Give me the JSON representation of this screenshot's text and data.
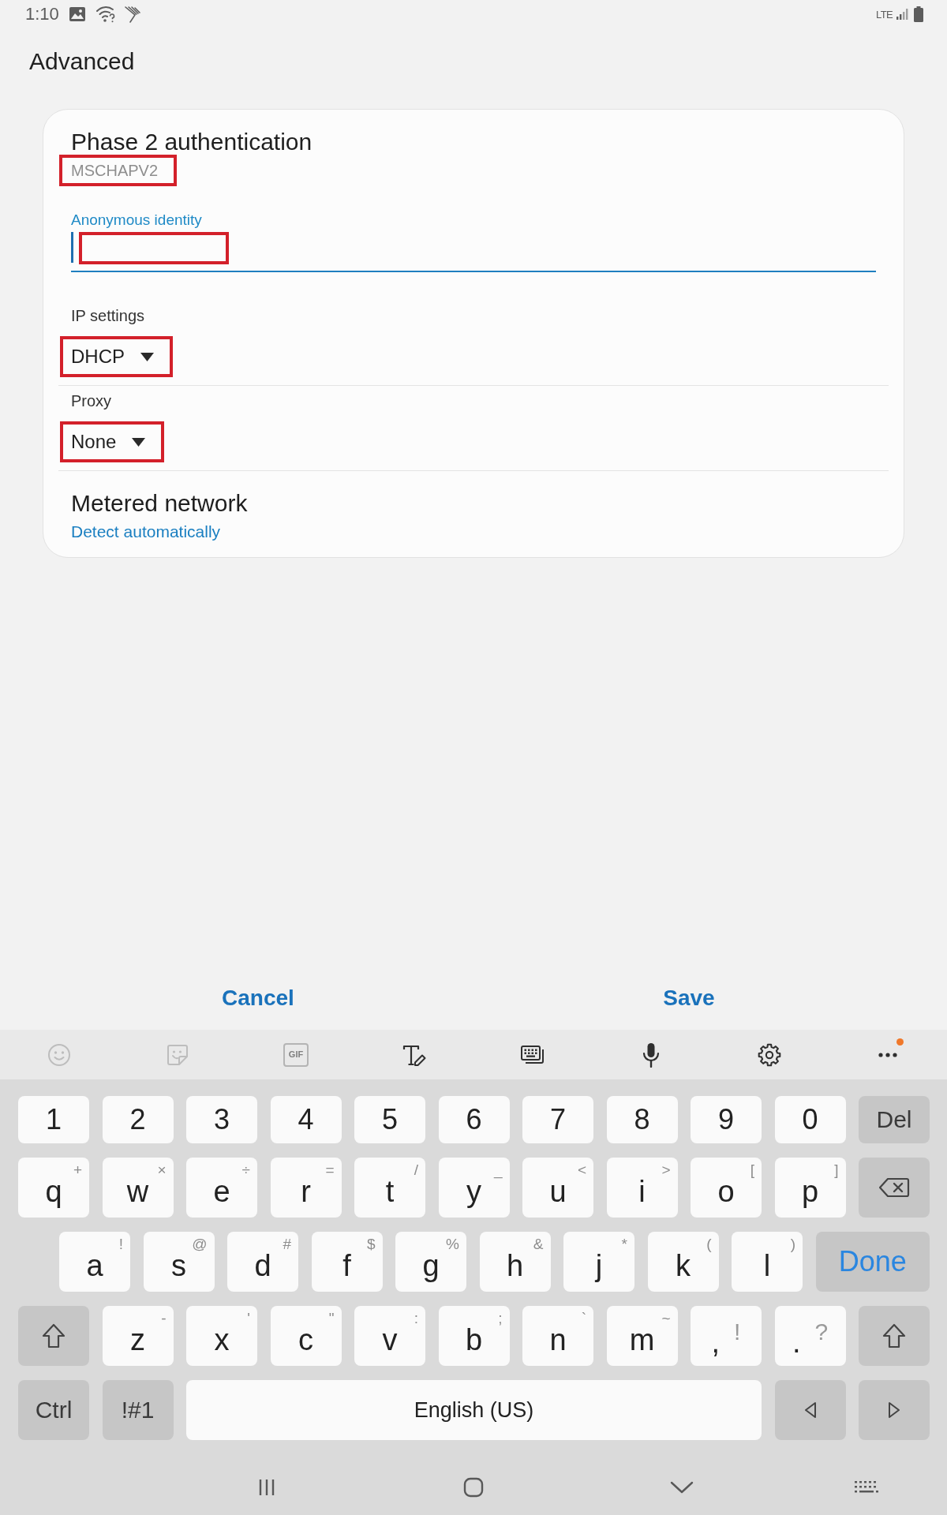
{
  "status_bar": {
    "time": "1:10",
    "network_type": "LTE"
  },
  "header": {
    "title": "Advanced"
  },
  "settings": [
    {
      "kind": "value",
      "title": "Phase 2 authentication",
      "value": "MSCHAPV2",
      "highlighted": true
    },
    {
      "kind": "input",
      "label": "Anonymous identity",
      "focused": true,
      "highlighted": true
    },
    {
      "kind": "dropdown",
      "label": "IP settings",
      "value": "DHCP",
      "highlighted": true
    },
    {
      "kind": "dropdown",
      "label": "Proxy",
      "value": "None",
      "highlighted": true
    },
    {
      "kind": "summary",
      "title": "Metered network",
      "value": "Detect automatically",
      "highlighted": false
    }
  ],
  "actions": [
    {
      "label": "Cancel"
    },
    {
      "label": "Save"
    }
  ],
  "keyboard": {
    "toolbar": [
      {
        "kind": "emoji",
        "disabled": true
      },
      {
        "kind": "sticker",
        "disabled": true
      },
      {
        "kind": "gif",
        "label": "GIF",
        "disabled": true
      },
      {
        "kind": "text-style",
        "disabled": false
      },
      {
        "kind": "keyboard-mode",
        "disabled": false
      },
      {
        "kind": "voice",
        "disabled": false
      },
      {
        "kind": "settings",
        "disabled": false
      },
      {
        "kind": "more",
        "disabled": false,
        "badge": true
      }
    ],
    "rows": [
      {
        "keys": [
          {
            "kind": "char",
            "label": "1"
          },
          {
            "kind": "char",
            "label": "2"
          },
          {
            "kind": "char",
            "label": "3"
          },
          {
            "kind": "char",
            "label": "4"
          },
          {
            "kind": "char",
            "label": "5"
          },
          {
            "kind": "char",
            "label": "6"
          },
          {
            "kind": "char",
            "label": "7"
          },
          {
            "kind": "char",
            "label": "8"
          },
          {
            "kind": "char",
            "label": "9"
          },
          {
            "kind": "char",
            "label": "0"
          },
          {
            "kind": "func",
            "label": "Del"
          }
        ]
      },
      {
        "keys": [
          {
            "kind": "char",
            "label": "q",
            "hint": "+"
          },
          {
            "kind": "char",
            "label": "w",
            "hint": "×"
          },
          {
            "kind": "char",
            "label": "e",
            "hint": "÷"
          },
          {
            "kind": "char",
            "label": "r",
            "hint": "="
          },
          {
            "kind": "char",
            "label": "t",
            "hint": "/"
          },
          {
            "kind": "char",
            "label": "y",
            "hint": "_"
          },
          {
            "kind": "char",
            "label": "u",
            "hint": "<"
          },
          {
            "kind": "char",
            "label": "i",
            "hint": ">"
          },
          {
            "kind": "char",
            "label": "o",
            "hint": "["
          },
          {
            "kind": "char",
            "label": "p",
            "hint": "]"
          },
          {
            "kind": "backspace"
          }
        ]
      },
      {
        "keys": [
          {
            "kind": "char",
            "label": "a",
            "hint": "!"
          },
          {
            "kind": "char",
            "label": "s",
            "hint": "@"
          },
          {
            "kind": "char",
            "label": "d",
            "hint": "#"
          },
          {
            "kind": "char",
            "label": "f",
            "hint": "$"
          },
          {
            "kind": "char",
            "label": "g",
            "hint": "%"
          },
          {
            "kind": "char",
            "label": "h",
            "hint": "&"
          },
          {
            "kind": "char",
            "label": "j",
            "hint": "*"
          },
          {
            "kind": "char",
            "label": "k",
            "hint": "("
          },
          {
            "kind": "char",
            "label": "l",
            "hint": ")"
          },
          {
            "kind": "done",
            "label": "Done"
          }
        ]
      },
      {
        "keys": [
          {
            "kind": "shift"
          },
          {
            "kind": "char",
            "label": "z",
            "hint": "-"
          },
          {
            "kind": "char",
            "label": "x",
            "hint": "'"
          },
          {
            "kind": "char",
            "label": "c",
            "hint": "\""
          },
          {
            "kind": "char",
            "label": "v",
            "hint": ":"
          },
          {
            "kind": "char",
            "label": "b",
            "hint": ";"
          },
          {
            "kind": "char",
            "label": "n",
            "hint": "`"
          },
          {
            "kind": "char",
            "label": "m",
            "hint": "~"
          },
          {
            "kind": "punct",
            "label": ",",
            "hint": "!"
          },
          {
            "kind": "punct",
            "label": ".",
            "hint": "?"
          },
          {
            "kind": "shift"
          }
        ]
      },
      {
        "keys": [
          {
            "kind": "func",
            "label": "Ctrl"
          },
          {
            "kind": "func",
            "label": "!#1"
          },
          {
            "kind": "space",
            "label": "English (US)"
          },
          {
            "kind": "left"
          },
          {
            "kind": "right"
          }
        ]
      }
    ]
  }
}
